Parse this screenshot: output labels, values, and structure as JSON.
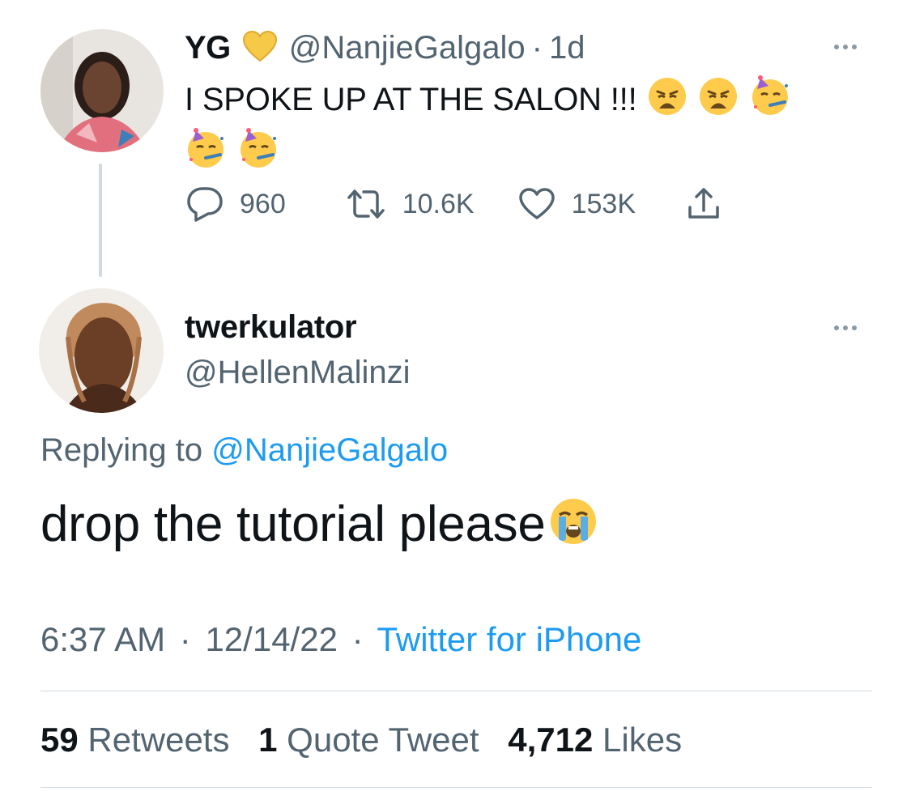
{
  "original_tweet": {
    "display_name": "YG",
    "handle": "@NanjieGalgalo",
    "separator": "·",
    "age": "1d",
    "text": "I SPOKE UP AT THE SALON !!!",
    "emojis": [
      "weary-face",
      "weary-face",
      "partying-face",
      "partying-face",
      "partying-face"
    ],
    "heart_color": "#f7c948",
    "actions": {
      "replies": "960",
      "retweets": "10.6K",
      "likes": "153K"
    }
  },
  "reply_tweet": {
    "display_name": "twerkulator",
    "handle": "@HellenMalinzi",
    "replying_prefix": "Replying to",
    "replying_handle": "@NanjieGalgalo",
    "text": "drop the tutorial please",
    "emoji": "loudly-crying-face",
    "time": "6:37 AM",
    "date": "12/14/22",
    "separator": "·",
    "source": "Twitter for iPhone",
    "stats": {
      "retweets_count": "59",
      "retweets_label": "Retweets",
      "quotes_count": "1",
      "quotes_label": "Quote Tweet",
      "likes_count": "4,712",
      "likes_label": "Likes"
    }
  },
  "colors": {
    "accent": "#1d9bf0",
    "text": "#0f1419",
    "secondary": "#536471",
    "divider": "#cfd9de"
  }
}
